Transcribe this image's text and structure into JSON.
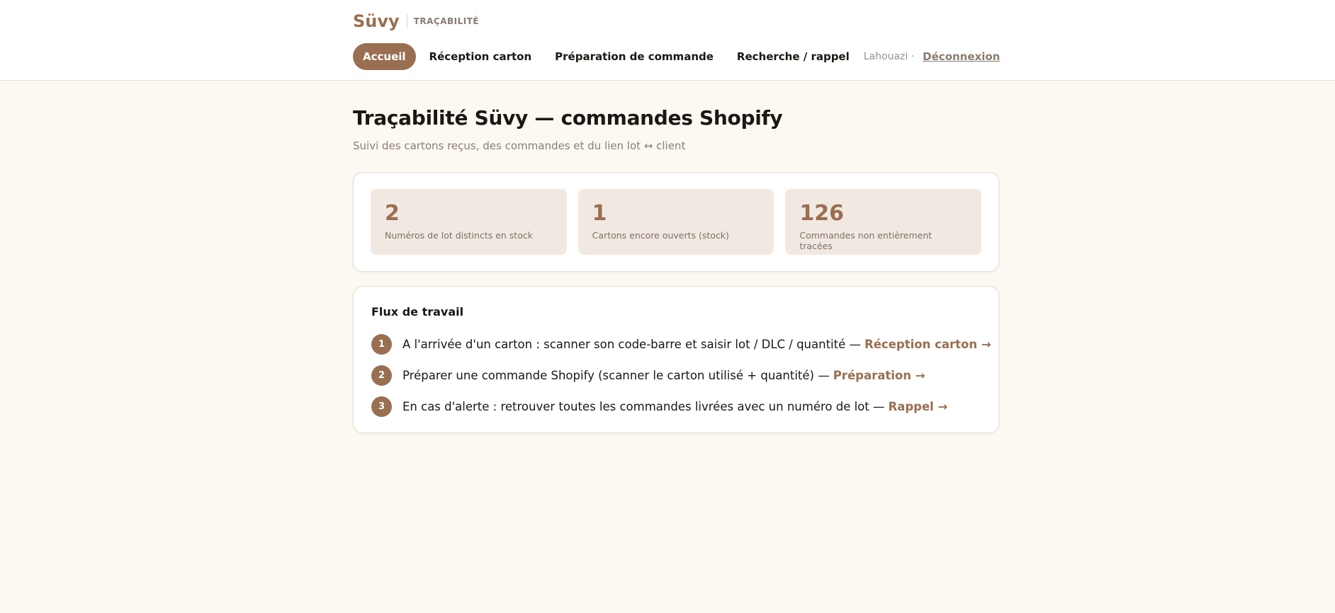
{
  "header": {
    "brand": "Süvy",
    "brand_sub": "TRAÇABILITÉ"
  },
  "nav": {
    "items": [
      {
        "label": "Accueil",
        "active": true
      },
      {
        "label": "Réception carton",
        "active": false
      },
      {
        "label": "Préparation de commande",
        "active": false
      },
      {
        "label": "Recherche / rappel",
        "active": false
      }
    ],
    "user": "Lahouazi ·",
    "logout": "Déconnexion"
  },
  "page": {
    "title": "Traçabilité Süvy — commandes Shopify",
    "subtitle": "Suivi des cartons reçus, des commandes et du lien lot ↔ client"
  },
  "stats": [
    {
      "value": "2",
      "label": "Numéros de lot distincts en stock"
    },
    {
      "value": "1",
      "label": "Cartons encore ouverts (stock)"
    },
    {
      "value": "126",
      "label": "Commandes non entièrement tracées"
    }
  ],
  "workflow": {
    "title": "Flux de travail",
    "steps": [
      {
        "num": "1",
        "text": "A l'arrivée d'un carton : scanner son code-barre et saisir lot / DLC / quantité —",
        "link": "Réception carton →"
      },
      {
        "num": "2",
        "text": "Préparer une commande Shopify (scanner le carton utilisé + quantité) —",
        "link": "Préparation →"
      },
      {
        "num": "3",
        "text": "En cas d'alerte : retrouver toutes les commandes livrées avec un numéro de lot —",
        "link": "Rappel →"
      }
    ]
  },
  "colors": {
    "accent": "#9a6e51",
    "background": "#fcf8f2",
    "stat_bg": "#f1e9e1"
  }
}
